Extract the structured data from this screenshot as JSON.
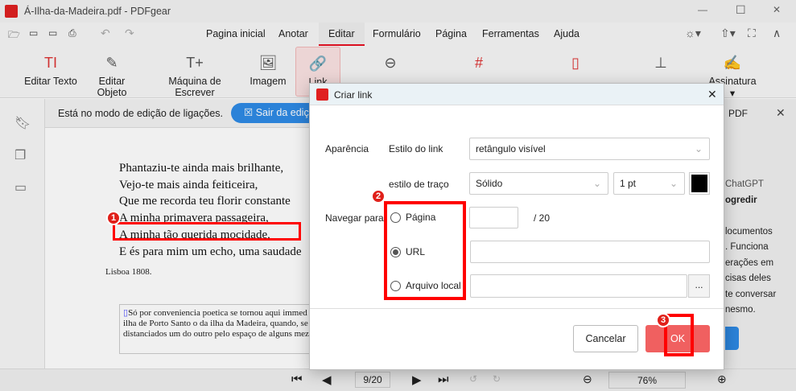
{
  "window": {
    "title": "Á-Ilha-da-Madeira.pdf - PDFgear",
    "controls": [
      "—",
      "☐",
      "✕"
    ]
  },
  "menu": {
    "tabs": [
      "Pagina inicial",
      "Anotar",
      "Editar",
      "Formulário",
      "Página",
      "Ferramentas",
      "Ajuda"
    ],
    "active": "Editar"
  },
  "ribbon": {
    "tools": [
      "Editar Texto",
      "Editar Objeto",
      "Máquina de Escrever",
      "Imagem",
      "Link",
      "",
      "",
      "",
      "",
      "Assinatura"
    ]
  },
  "notification": {
    "text": "Está no modo de edição de ligações.",
    "exit_button": "Sair da edição"
  },
  "document": {
    "poem": [
      "Phantaziu-te ainda mais brilhante,",
      "Vejo-te mais ainda feiticeira,",
      "Que me recorda teu florir constante",
      "A minha primavera passageira,",
      "A minha tão querida mocidade,",
      "E és para mim um echo, uma saudade"
    ],
    "place_date": "Lisboa 1808.",
    "footnote": [
      "Só por conveniencia poetica se tornou aqui immed",
      "ilha de Porto Santo o da ilha da Madeira, quando, se",
      "distanciados um do outro pelo espaço de alguns mez"
    ]
  },
  "right_panel": {
    "title": "PDF",
    "lines": [
      "ChatGPT",
      "ogredir",
      "",
      "locumentos",
      ".  Funciona",
      "erações em",
      "cisas deles",
      "te conversar",
      "nesmo."
    ]
  },
  "bottom_bar": {
    "page_indicator": "9/20",
    "zoom": "76%"
  },
  "dialog": {
    "title": "Criar link",
    "appearance_label": "Aparência",
    "link_style_label": "Estilo do link",
    "link_style_value": "retângulo visível",
    "stroke_style_label": "estilo de traço",
    "stroke_style_value": "Sólido",
    "stroke_width_value": "1 pt",
    "stroke_color": "#000000",
    "navigate_label": "Navegar para",
    "options": [
      {
        "label": "Página",
        "selected": false
      },
      {
        "label": "URL",
        "selected": true
      },
      {
        "label": "Arquivo local",
        "selected": false
      }
    ],
    "page_value": "",
    "page_total": "/ 20",
    "url_value": "",
    "file_value": "",
    "browse_button": "...",
    "cancel_button": "Cancelar",
    "ok_button": "OK"
  },
  "annotations": [
    "1",
    "2",
    "3"
  ],
  "colors": {
    "accent": "#e81123",
    "primary_blue": "#2e8be6",
    "ok_button": "#f06060",
    "highlight": "#ff0000"
  }
}
